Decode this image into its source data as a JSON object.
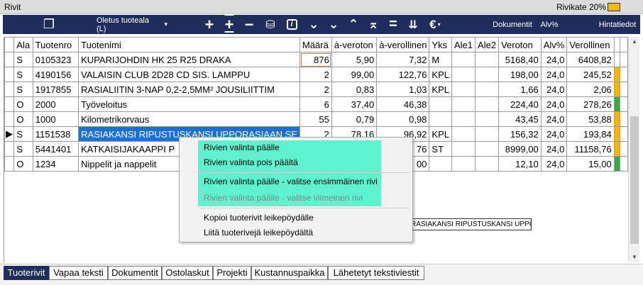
{
  "window": {
    "title": "Rivit",
    "rivikate_label": "Rivikate 20%",
    "rivikate_color": "#f5b800"
  },
  "toolbar": {
    "icons": {
      "copy": "❐",
      "add": "+",
      "insert": "+",
      "remove": "−",
      "coins": "⛁",
      "info": "i",
      "down": "⌄",
      "down2": "⌄",
      "up": "⌃",
      "top": "⌅",
      "equals": "=",
      "sort": "⇊",
      "euro": "€"
    },
    "euro_caret": "▾",
    "product_area": "Oletus tuoteala (L)",
    "product_area_caret": "▾",
    "documents": "Dokumentit",
    "vat": "Alv%",
    "price_info": "Hintatiedot"
  },
  "grid": {
    "headers": [
      "Ala",
      "Tuotenro",
      "Tuotenimi",
      "Määrä",
      "à-veroton",
      "à-verollinen",
      "Yks",
      "Ale1",
      "Ale2",
      "Veroton",
      "Alv%",
      "Verollinen"
    ],
    "current_marker": "▶",
    "rows": [
      {
        "ala": "S",
        "no": "0105323",
        "name": "KUPARIJOHDIN HK 25 R25 DRAKA",
        "qty": "876",
        "unit_net": "5,90",
        "unit_gross": "7,32",
        "unit": "M",
        "ale1": "",
        "ale2": "",
        "net": "5168,40",
        "vat": "24,0",
        "gross": "6408,82",
        "color": ""
      },
      {
        "ala": "S",
        "no": "4190156",
        "name": "VALAISIN CLUB 2D28 CD SIS. LAMPPU",
        "qty": "2",
        "unit_net": "99,00",
        "unit_gross": "122,76",
        "unit": "KPL",
        "ale1": "",
        "ale2": "",
        "net": "198,00",
        "vat": "24,0",
        "gross": "245,52",
        "color": "#f5b800"
      },
      {
        "ala": "S",
        "no": "1917855",
        "name": "RASIALIITIN 3-NAP 0,2-2,5MM² JOUSILIITTIM",
        "qty": "2",
        "unit_net": "0,83",
        "unit_gross": "1,03",
        "unit": "KPL",
        "ale1": "",
        "ale2": "",
        "net": "1,66",
        "vat": "24,0",
        "gross": "2,06",
        "color": "#f5b800"
      },
      {
        "ala": "O",
        "no": "2000",
        "name": "Työveloitus",
        "qty": "6",
        "unit_net": "37,40",
        "unit_gross": "46,38",
        "unit": "",
        "ale1": "",
        "ale2": "",
        "net": "224,40",
        "vat": "24,0",
        "gross": "278,26",
        "color": "#3aa845"
      },
      {
        "ala": "O",
        "no": "1000",
        "name": "Kilometrikorvaus",
        "qty": "55",
        "unit_net": "0,79",
        "unit_gross": "0,98",
        "unit": "",
        "ale1": "",
        "ale2": "",
        "net": "43,45",
        "vat": "24,0",
        "gross": "53,88",
        "color": "#f5b800"
      },
      {
        "ala": "S",
        "no": "1151538",
        "name": "RASIAKANSI RIPUSTUSKANSI UPPORASIAAN SE",
        "qty": "2",
        "unit_net": "78,16",
        "unit_gross": "96,92",
        "unit": "KPL",
        "ale1": "",
        "ale2": "",
        "net": "156,32",
        "vat": "24,0",
        "gross": "193,84",
        "color": "#f5b800"
      },
      {
        "ala": "S",
        "no": "5441401",
        "name": "KATKAISIJAKAAPPI P",
        "qty": "",
        "unit_net": "",
        "unit_gross": "76",
        "unit": "ST",
        "ale1": "",
        "ale2": "",
        "net": "8999,00",
        "vat": "24,0",
        "gross": "11158,76",
        "color": "#f5b800"
      },
      {
        "ala": "O",
        "no": "1234",
        "name": "Nippelit ja nappelit",
        "qty": "",
        "unit_net": "",
        "unit_gross": "00",
        "unit": "",
        "ale1": "",
        "ale2": "",
        "net": "12,10",
        "vat": "24,0",
        "gross": "15,00",
        "color": "#3aa845"
      }
    ]
  },
  "tooltip": "RASIAKANSI RIPUSTUSKANSI UPPORASIAAN SELC",
  "context_menu": {
    "items": [
      {
        "label": "Rivien valinta päälle",
        "disabled": false
      },
      {
        "label": "Rivien valinta pois päältä",
        "disabled": false
      },
      {
        "label": "Rivien valinta päälle - valitse ensimmäinen rivi",
        "disabled": false
      },
      {
        "label": "Rivien valinta päälle - valitse viimeinen rivi",
        "disabled": true
      },
      {
        "label": "Kopioi tuoterivit leikepöydälle",
        "disabled": false
      },
      {
        "label": "Liitä tuoterivejä leikepöydältä",
        "disabled": false
      }
    ]
  },
  "scrollbar": {
    "up": "▲",
    "down": "▼"
  },
  "tabs": [
    "Tuoterivit",
    "Vapaa teksti",
    "Dokumentit",
    "Ostolaskut",
    "Projekti",
    "Kustannuspaikka",
    "Lähetetyt tekstiviestit"
  ]
}
